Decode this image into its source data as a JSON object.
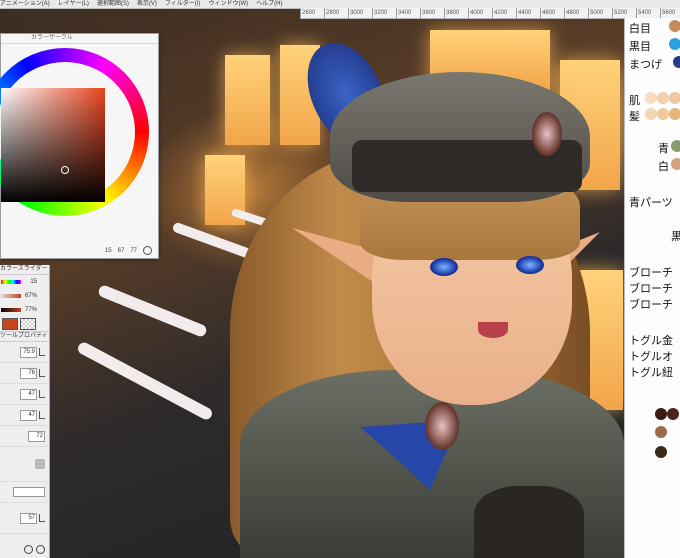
{
  "menubar": {
    "items": [
      "アニメーション(A)",
      "レイヤー(L)",
      "選択範囲(S)",
      "表示(V)",
      "フィルター(I)",
      "ウィンドウ(W)",
      "ヘルプ(H)"
    ]
  },
  "ruler": {
    "ticks": [
      "2600",
      "2800",
      "3000",
      "3200",
      "3400",
      "3600",
      "3800",
      "4000",
      "4200",
      "4400",
      "4600",
      "4800",
      "5000",
      "5200",
      "5400",
      "5600",
      "5800",
      "6000",
      "6200",
      "6400",
      "6600",
      "6800",
      "7000",
      "7200",
      "7400"
    ]
  },
  "color_circle": {
    "title": "カラーサークル",
    "hsv": [
      "15",
      "67",
      "77"
    ]
  },
  "color_slider": {
    "title": "カラースライダー",
    "values": [
      "15",
      "67%",
      "77%"
    ]
  },
  "tool_property": {
    "title": "ツールプロパティ",
    "values": [
      "75.9",
      "76",
      "47",
      "47",
      "72",
      "57"
    ]
  },
  "memo": {
    "lines": [
      "白目",
      "黒目",
      "まつげ",
      "肌",
      "髪",
      "青",
      "白",
      "青パーツ",
      "黒",
      "ブローチ",
      "ブローチ",
      "ブローチ",
      "トグル金",
      "トグルオ",
      "トグル紐"
    ],
    "colors": {
      "white_eye": "#c88a5a",
      "black_eye": "#2a9fe0",
      "black_eye2": "#1a5ab0",
      "lash": "#2a3a8a",
      "skin": [
        "#f7dcc0",
        "#f4cfae",
        "#f0c7a0"
      ],
      "hair": [
        "#f3d7b0",
        "#f0c89a",
        "#e8b47a"
      ],
      "blue": "#8a9a6e",
      "white": "#d1a183",
      "brooch_dots": [
        "#3a1a12",
        "#4a2418",
        "#9a6a4a",
        "#3a2a18"
      ]
    }
  }
}
